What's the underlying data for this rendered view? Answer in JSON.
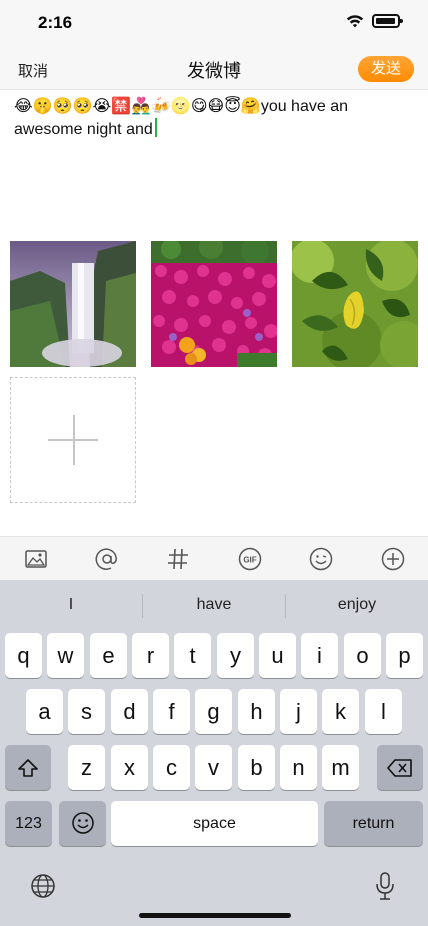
{
  "status": {
    "time": "2:16"
  },
  "nav": {
    "cancel": "取消",
    "title": "发微博",
    "send": "发送",
    "send_color": "#ff9a1a"
  },
  "compose": {
    "emoji_prefix": "😂🤫🥺🥺😭🈲👨‍❤️‍👨🍻🌝😋😷😇🤗",
    "text": "you have an awesome night and"
  },
  "photos": [
    {
      "name": "waterfall-photo"
    },
    {
      "name": "flowers-photo"
    },
    {
      "name": "leaves-photo"
    }
  ],
  "toolbar": {
    "icons": [
      "image-icon",
      "at-icon",
      "hashtag-icon",
      "gif-icon",
      "emoji-icon",
      "add-icon"
    ]
  },
  "keyboard": {
    "suggestions": [
      "I",
      "have",
      "enjoy"
    ],
    "row1": [
      "q",
      "w",
      "e",
      "r",
      "t",
      "y",
      "u",
      "i",
      "o",
      "p"
    ],
    "row2": [
      "a",
      "s",
      "d",
      "f",
      "g",
      "h",
      "j",
      "k",
      "l"
    ],
    "row3": [
      "z",
      "x",
      "c",
      "v",
      "b",
      "n",
      "m"
    ],
    "numbers_key": "123",
    "space_key": "space",
    "return_key": "return"
  }
}
